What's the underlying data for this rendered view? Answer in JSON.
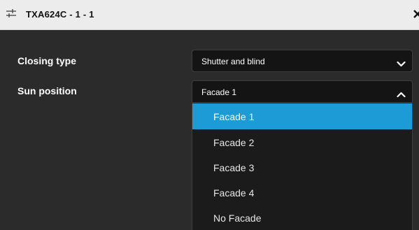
{
  "window": {
    "title": "TXA624C - 1 - 1",
    "title_icon": "sliders-icon",
    "close_icon": "close-icon"
  },
  "form": {
    "closing_type": {
      "label": "Closing type",
      "value": "Shutter and blind",
      "expanded": false
    },
    "sun_position": {
      "label": "Sun position",
      "value": "Facade 1",
      "expanded": true,
      "options": [
        {
          "label": "Facade 1",
          "selected": true
        },
        {
          "label": "Facade 2",
          "selected": false
        },
        {
          "label": "Facade 3",
          "selected": false
        },
        {
          "label": "Facade 4",
          "selected": false
        },
        {
          "label": "No Facade",
          "selected": false
        }
      ]
    }
  },
  "colors": {
    "panel_bg": "#2b2b2b",
    "titlebar_bg": "#ececec",
    "select_bg": "#141414",
    "selected_option_bg": "#1d9bd6"
  }
}
